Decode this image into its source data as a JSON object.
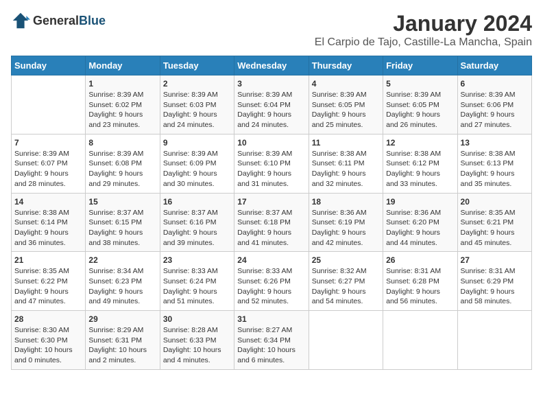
{
  "header": {
    "logo_general": "General",
    "logo_blue": "Blue",
    "title": "January 2024",
    "subtitle": "El Carpio de Tajo, Castille-La Mancha, Spain"
  },
  "weekdays": [
    "Sunday",
    "Monday",
    "Tuesday",
    "Wednesday",
    "Thursday",
    "Friday",
    "Saturday"
  ],
  "weeks": [
    [
      {
        "day": "",
        "info": ""
      },
      {
        "day": "1",
        "info": "Sunrise: 8:39 AM\nSunset: 6:02 PM\nDaylight: 9 hours\nand 23 minutes."
      },
      {
        "day": "2",
        "info": "Sunrise: 8:39 AM\nSunset: 6:03 PM\nDaylight: 9 hours\nand 24 minutes."
      },
      {
        "day": "3",
        "info": "Sunrise: 8:39 AM\nSunset: 6:04 PM\nDaylight: 9 hours\nand 24 minutes."
      },
      {
        "day": "4",
        "info": "Sunrise: 8:39 AM\nSunset: 6:05 PM\nDaylight: 9 hours\nand 25 minutes."
      },
      {
        "day": "5",
        "info": "Sunrise: 8:39 AM\nSunset: 6:05 PM\nDaylight: 9 hours\nand 26 minutes."
      },
      {
        "day": "6",
        "info": "Sunrise: 8:39 AM\nSunset: 6:06 PM\nDaylight: 9 hours\nand 27 minutes."
      }
    ],
    [
      {
        "day": "7",
        "info": "Sunrise: 8:39 AM\nSunset: 6:07 PM\nDaylight: 9 hours\nand 28 minutes."
      },
      {
        "day": "8",
        "info": "Sunrise: 8:39 AM\nSunset: 6:08 PM\nDaylight: 9 hours\nand 29 minutes."
      },
      {
        "day": "9",
        "info": "Sunrise: 8:39 AM\nSunset: 6:09 PM\nDaylight: 9 hours\nand 30 minutes."
      },
      {
        "day": "10",
        "info": "Sunrise: 8:39 AM\nSunset: 6:10 PM\nDaylight: 9 hours\nand 31 minutes."
      },
      {
        "day": "11",
        "info": "Sunrise: 8:38 AM\nSunset: 6:11 PM\nDaylight: 9 hours\nand 32 minutes."
      },
      {
        "day": "12",
        "info": "Sunrise: 8:38 AM\nSunset: 6:12 PM\nDaylight: 9 hours\nand 33 minutes."
      },
      {
        "day": "13",
        "info": "Sunrise: 8:38 AM\nSunset: 6:13 PM\nDaylight: 9 hours\nand 35 minutes."
      }
    ],
    [
      {
        "day": "14",
        "info": "Sunrise: 8:38 AM\nSunset: 6:14 PM\nDaylight: 9 hours\nand 36 minutes."
      },
      {
        "day": "15",
        "info": "Sunrise: 8:37 AM\nSunset: 6:15 PM\nDaylight: 9 hours\nand 38 minutes."
      },
      {
        "day": "16",
        "info": "Sunrise: 8:37 AM\nSunset: 6:16 PM\nDaylight: 9 hours\nand 39 minutes."
      },
      {
        "day": "17",
        "info": "Sunrise: 8:37 AM\nSunset: 6:18 PM\nDaylight: 9 hours\nand 41 minutes."
      },
      {
        "day": "18",
        "info": "Sunrise: 8:36 AM\nSunset: 6:19 PM\nDaylight: 9 hours\nand 42 minutes."
      },
      {
        "day": "19",
        "info": "Sunrise: 8:36 AM\nSunset: 6:20 PM\nDaylight: 9 hours\nand 44 minutes."
      },
      {
        "day": "20",
        "info": "Sunrise: 8:35 AM\nSunset: 6:21 PM\nDaylight: 9 hours\nand 45 minutes."
      }
    ],
    [
      {
        "day": "21",
        "info": "Sunrise: 8:35 AM\nSunset: 6:22 PM\nDaylight: 9 hours\nand 47 minutes."
      },
      {
        "day": "22",
        "info": "Sunrise: 8:34 AM\nSunset: 6:23 PM\nDaylight: 9 hours\nand 49 minutes."
      },
      {
        "day": "23",
        "info": "Sunrise: 8:33 AM\nSunset: 6:24 PM\nDaylight: 9 hours\nand 51 minutes."
      },
      {
        "day": "24",
        "info": "Sunrise: 8:33 AM\nSunset: 6:26 PM\nDaylight: 9 hours\nand 52 minutes."
      },
      {
        "day": "25",
        "info": "Sunrise: 8:32 AM\nSunset: 6:27 PM\nDaylight: 9 hours\nand 54 minutes."
      },
      {
        "day": "26",
        "info": "Sunrise: 8:31 AM\nSunset: 6:28 PM\nDaylight: 9 hours\nand 56 minutes."
      },
      {
        "day": "27",
        "info": "Sunrise: 8:31 AM\nSunset: 6:29 PM\nDaylight: 9 hours\nand 58 minutes."
      }
    ],
    [
      {
        "day": "28",
        "info": "Sunrise: 8:30 AM\nSunset: 6:30 PM\nDaylight: 10 hours\nand 0 minutes."
      },
      {
        "day": "29",
        "info": "Sunrise: 8:29 AM\nSunset: 6:31 PM\nDaylight: 10 hours\nand 2 minutes."
      },
      {
        "day": "30",
        "info": "Sunrise: 8:28 AM\nSunset: 6:33 PM\nDaylight: 10 hours\nand 4 minutes."
      },
      {
        "day": "31",
        "info": "Sunrise: 8:27 AM\nSunset: 6:34 PM\nDaylight: 10 hours\nand 6 minutes."
      },
      {
        "day": "",
        "info": ""
      },
      {
        "day": "",
        "info": ""
      },
      {
        "day": "",
        "info": ""
      }
    ]
  ]
}
